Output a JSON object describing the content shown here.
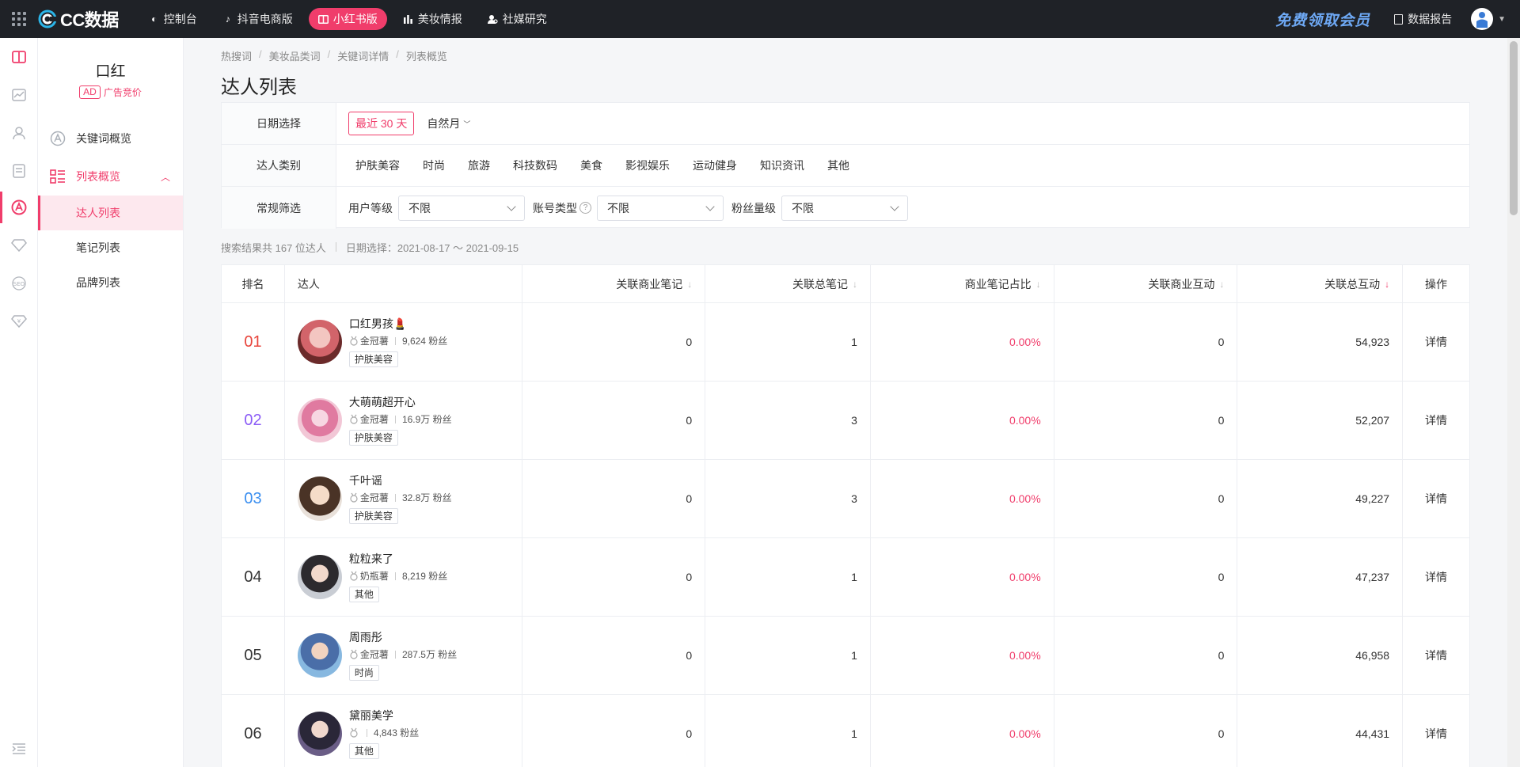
{
  "topbar": {
    "brand": "CC数据",
    "nav": [
      {
        "label": "控制台",
        "icon": "dashboard-icon"
      },
      {
        "label": "抖音电商版",
        "icon": "douyin-icon"
      },
      {
        "label": "小红书版",
        "icon": "book-icon",
        "active": true
      },
      {
        "label": "美妆情报",
        "icon": "chart-bars-icon"
      },
      {
        "label": "社媒研究",
        "icon": "user-search-icon"
      }
    ],
    "vip": "免费领取会员",
    "report": "数据报告"
  },
  "sidebar": {
    "keyword": "口红",
    "ad_badge": "AD",
    "ad_label": "广告竞价",
    "items": [
      {
        "label": "关键词概览"
      },
      {
        "label": "列表概览"
      }
    ],
    "subitems": [
      {
        "label": "达人列表",
        "active": true
      },
      {
        "label": "笔记列表"
      },
      {
        "label": "品牌列表"
      }
    ]
  },
  "breadcrumb": [
    "热搜词",
    "美妆品类词",
    "关键词详情",
    "列表概览"
  ],
  "page_title": "达人列表",
  "filters": {
    "date_label": "日期选择",
    "date_selected": "最近 30 天",
    "date_natural": "自然月",
    "category_label": "达人类别",
    "categories": [
      "护肤美容",
      "时尚",
      "旅游",
      "科技数码",
      "美食",
      "影视娱乐",
      "运动健身",
      "知识资讯",
      "其他"
    ],
    "general_label": "常规筛选",
    "user_level_label": "用户等级",
    "user_level_value": "不限",
    "account_type_label": "账号类型",
    "account_type_value": "不限",
    "fans_label": "粉丝量级",
    "fans_value": "不限"
  },
  "summary": {
    "count_text": "搜索结果共 167 位达人",
    "date_text": "日期选择：2021-08-17 ～ 2021-09-15"
  },
  "table": {
    "headers": {
      "rank": "排名",
      "user": "达人",
      "biz_notes": "关联商业笔记",
      "total_notes": "关联总笔记",
      "biz_ratio": "商业笔记占比",
      "biz_interact": "关联商业互动",
      "total_interact": "关联总互动",
      "op": "操作"
    },
    "rows": [
      {
        "rank": "01",
        "rank_color": "#e8453c",
        "name": "口红男孩💄",
        "level": "金冠薯",
        "fans": "9,624 粉丝",
        "tag": "护肤美容",
        "biz_notes": "0",
        "total_notes": "1",
        "ratio": "0.00%",
        "biz_interact": "0",
        "total_interact": "54,923",
        "op": "详情"
      },
      {
        "rank": "02",
        "rank_color": "#8b5cf6",
        "name": "大萌萌超开心",
        "level": "金冠薯",
        "fans": "16.9万 粉丝",
        "tag": "护肤美容",
        "biz_notes": "0",
        "total_notes": "3",
        "ratio": "0.00%",
        "biz_interact": "0",
        "total_interact": "52,207",
        "op": "详情"
      },
      {
        "rank": "03",
        "rank_color": "#3b8ff0",
        "name": "千叶谣",
        "level": "金冠薯",
        "fans": "32.8万 粉丝",
        "tag": "护肤美容",
        "biz_notes": "0",
        "total_notes": "3",
        "ratio": "0.00%",
        "biz_interact": "0",
        "total_interact": "49,227",
        "op": "详情"
      },
      {
        "rank": "04",
        "rank_color": "#333333",
        "name": "粒粒来了",
        "level": "奶瓶薯",
        "fans": "8,219 粉丝",
        "tag": "其他",
        "biz_notes": "0",
        "total_notes": "1",
        "ratio": "0.00%",
        "biz_interact": "0",
        "total_interact": "47,237",
        "op": "详情"
      },
      {
        "rank": "05",
        "rank_color": "#333333",
        "name": "周雨彤",
        "level": "金冠薯",
        "fans": "287.5万 粉丝",
        "tag": "时尚",
        "biz_notes": "0",
        "total_notes": "1",
        "ratio": "0.00%",
        "biz_interact": "0",
        "total_interact": "46,958",
        "op": "详情"
      },
      {
        "rank": "06",
        "rank_color": "#333333",
        "name": "黛丽美学",
        "level": "",
        "fans": "4,843 粉丝",
        "tag": "其他",
        "biz_notes": "0",
        "total_notes": "1",
        "ratio": "0.00%",
        "biz_interact": "0",
        "total_interact": "44,431",
        "op": "详情"
      }
    ]
  },
  "colors": {
    "accent": "#f03d6b",
    "topbar": "#1f2227",
    "vip": "#6ea9f5"
  }
}
